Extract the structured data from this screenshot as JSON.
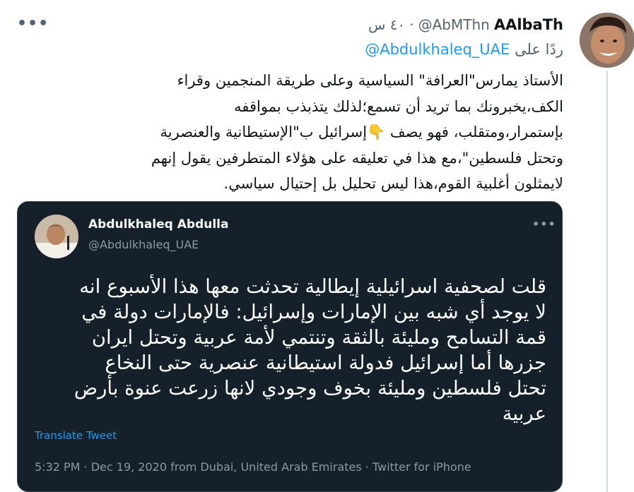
{
  "tweet": {
    "display_name": "AAlbaTh",
    "handle": "@AbMThn",
    "separator": "·",
    "time": "٤٠ س",
    "reply_prefix": "ردًا على",
    "reply_to": "@Abdulkhaleq_UAE",
    "text_lines": [
      "الأستاذ يمارس\"العرافة\" السياسية وعلى طريقة المنجمين وقراء",
      "الكف،يخبرونك بما تريد أن تسمع؛لذلك يتذبذب بمواقفه",
      "بإستمرار،ومتقلب، فهو يصف 👇إسرائيل ب\"الإستيطانية والعنصرية",
      "وتحتل فلسطين\"،مع هذا في تعليقه على هؤلاء المتطرفين يقول إنهم",
      "لايمثلون أغلبية القوم،هذا ليس تحليل بل إحتيال سياسي."
    ],
    "more_icon": "more-horizontal-icon"
  },
  "quoted": {
    "display_name": "Abdulkhaleq Abdulla",
    "handle": "@Abdulkhaleq_UAE",
    "text_lines": [
      "قلت لصحفية اسرائيلية إيطالية تحدثت  معها هذا الأسبوع انه",
      "لا يوجد أي شبه بين الإمارات وإسرائيل: فالإمارات دولة في",
      "قمة التسامح ومليئة بالثقة وتنتمي لأمة عربية وتحتل ايران",
      "جزرها أما إسرائيل فدولة استيطانية عنصرية حتى النخاع",
      "تحتل فلسطين ومليئة بخوف وجودي لانها زرعت عنوة بأرض",
      "عربية"
    ],
    "translate_label": "Translate Tweet",
    "meta": "5:32 PM · Dec 19, 2020 from Dubai, United Arab Emirates · Twitter for iPhone",
    "more_icon": "more-horizontal-icon"
  },
  "colors": {
    "link": "#1d9bf0",
    "muted": "#536471",
    "card_bg": "#15202b"
  }
}
